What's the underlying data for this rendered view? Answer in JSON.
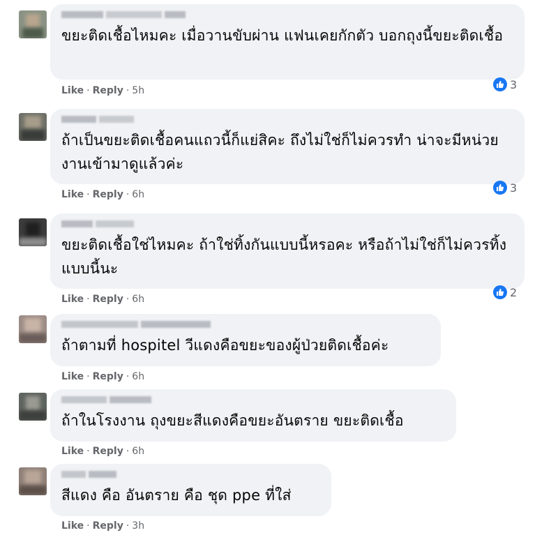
{
  "comments": [
    {
      "text": "ขยะติดเชื้อไหมคะ เมื่อวานขับผ่าน แฟนเคยกักตัว บอกถุงนี้ขยะติดเชื้อ",
      "like": "Like",
      "reply": "Reply",
      "time": "5h",
      "reactions": "3"
    },
    {
      "text": "ถ้าเป็นขยะติดเชื้อคนแถวนี้ก็แย่สิคะ ถึงไม่ใช่ก็ไม่ควรทำ น่าจะมีหน่วยงานเข้ามาดูแล้วค่ะ",
      "like": "Like",
      "reply": "Reply",
      "time": "6h",
      "reactions": "3"
    },
    {
      "text": "ขยะติดเชื้อใช่ไหมคะ ถ้าใช่ทิ้งกันแบบนี้หรอคะ หรือถ้าไม่ใช่ก็ไม่ควรทิ้งแบบนี้นะ",
      "like": "Like",
      "reply": "Reply",
      "time": "6h",
      "reactions": "2"
    },
    {
      "text": "ถ้าตามที่ hospitel วีแดงคือขยะของผู้ป่วยติดเชื้อค่ะ",
      "like": "Like",
      "reply": "Reply",
      "time": "6h"
    },
    {
      "text": "ถ้าในโรงงาน ถุงขยะสีแดงคือขยะอันตราย ขยะติดเชื้อ",
      "like": "Like",
      "reply": "Reply",
      "time": "6h"
    },
    {
      "text": "สีแดง คือ อันตราย คือ ชุด ppe ที่ใส่",
      "like": "Like",
      "reply": "Reply",
      "time": "3h"
    }
  ],
  "separator": "·",
  "colors": {
    "bubble": "#f0f2f5",
    "text": "#050505",
    "meta": "#65676b",
    "like_blue": "#1877f2"
  },
  "icons": {
    "reaction": "thumbs-up-icon",
    "avatar": "blurred-avatar"
  }
}
